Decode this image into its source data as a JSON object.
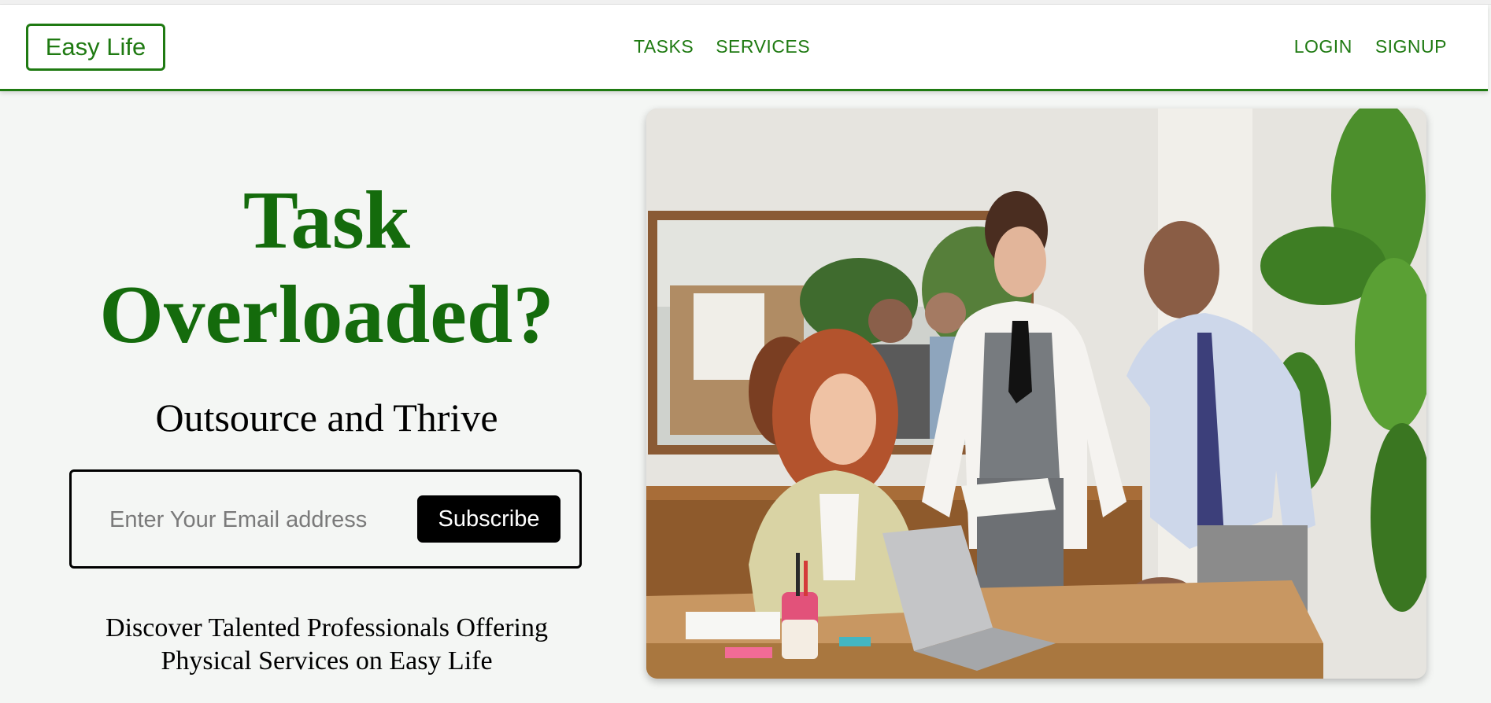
{
  "brand": {
    "name": "Easy Life"
  },
  "nav": {
    "center": [
      {
        "label": "TASKS"
      },
      {
        "label": "SERVICES"
      }
    ],
    "right": [
      {
        "label": "LOGIN"
      },
      {
        "label": "SIGNUP"
      }
    ]
  },
  "hero": {
    "title_line1": "Task",
    "title_line2": "Overloaded?",
    "subtitle": "Outsource and Thrive",
    "email_placeholder": "Enter Your Email address",
    "subscribe_label": "Subscribe",
    "tagline_line1": "Discover Talented Professionals Offering",
    "tagline_line2": "Physical Services on Easy Life"
  },
  "colors": {
    "brand_green": "#1f7a12",
    "title_green": "#146b0c",
    "background": "#f4f6f4",
    "button_black": "#000000"
  }
}
